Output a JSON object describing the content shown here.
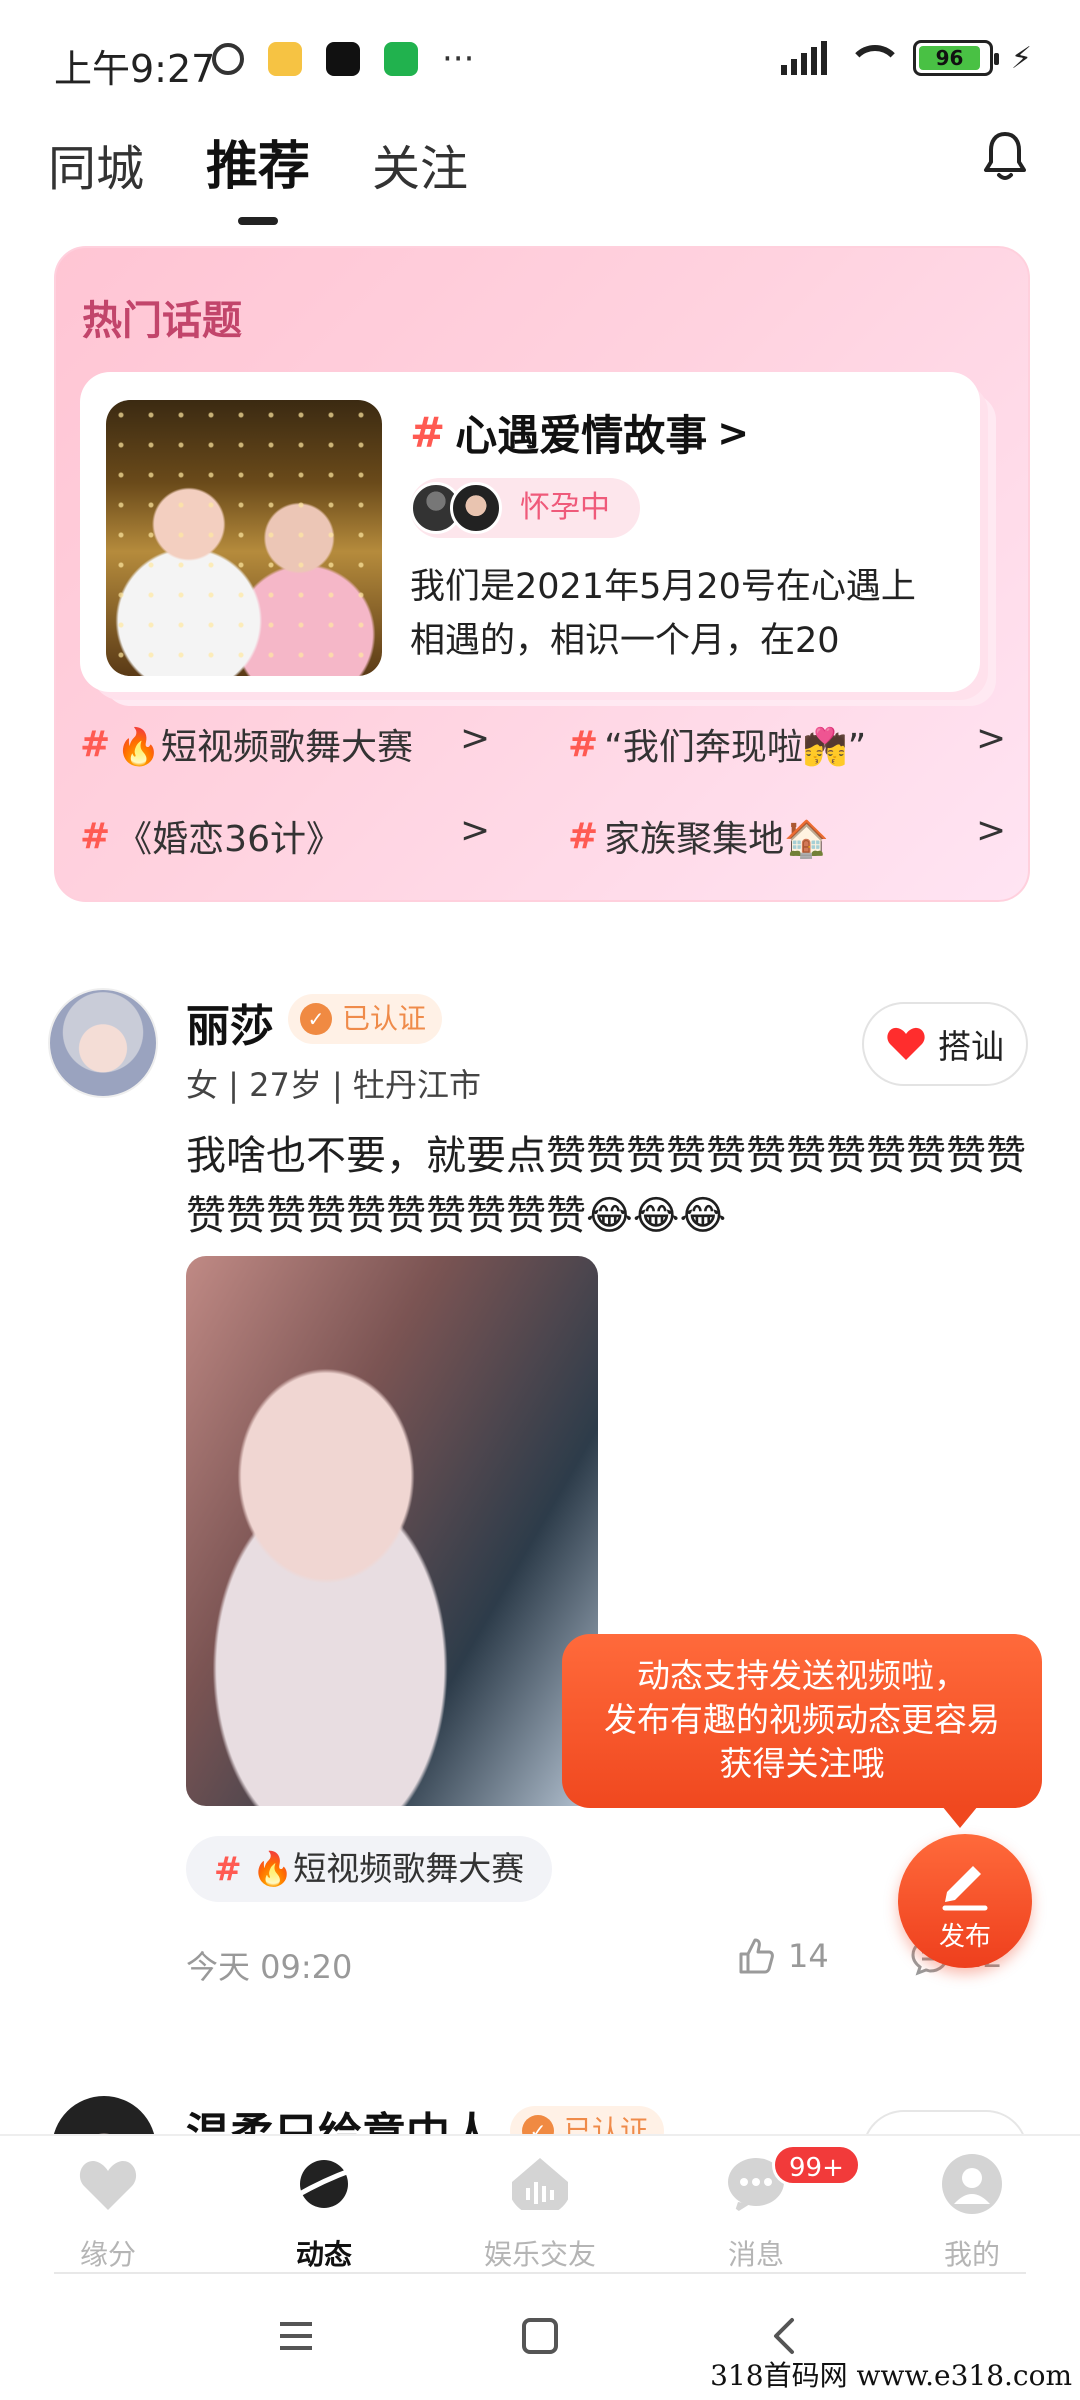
{
  "status_bar": {
    "time": "上午9:27",
    "more": "···",
    "battery": "96"
  },
  "tabs": {
    "nearby": "同城",
    "recommend": "推荐",
    "follow": "关注"
  },
  "hot_topics": {
    "title": "热门话题",
    "featured": {
      "hash": "#",
      "title": "心遇爱情故事",
      "arrow": ">",
      "tag": "怀孕中",
      "text": "我们是2021年5月20号在心遇上相遇的，相识一个月，在20"
    },
    "items": [
      {
        "hash": "#",
        "label": "🔥短视频歌舞大赛"
      },
      {
        "hash": "#",
        "label": "“我们奔现啦💏”"
      },
      {
        "hash": "#",
        "label": "《婚恋36计》"
      },
      {
        "hash": "#",
        "label": "家族聚集地🏠"
      }
    ],
    "chevron": ">"
  },
  "post": {
    "name": "丽莎",
    "verified": "已认证",
    "meta": "女 | 27岁 | 牡丹江市",
    "chat_button": "搭讪",
    "text": "我啥也不要，就要点赞赞赞赞赞赞赞赞赞赞赞赞赞赞赞赞赞赞赞赞赞赞😂😂😂",
    "topic_hash": "#",
    "topic": "🔥短视频歌舞大赛",
    "time": "今天 09:20",
    "likes": "14",
    "comments": "12"
  },
  "tooltip": {
    "line1": "动态支持发送视频啦，",
    "line2": "发布有趣的视频动态更容易",
    "line3": "获得关注哦"
  },
  "fab": {
    "label": "发布"
  },
  "next_post": {
    "name": "温柔只给意中人",
    "verified": "已认证"
  },
  "bottom_nav": {
    "items": [
      {
        "label": "缘分"
      },
      {
        "label": "动态"
      },
      {
        "label": "娱乐交友"
      },
      {
        "label": "消息"
      },
      {
        "label": "我的"
      }
    ],
    "badge": "99+"
  },
  "watermark": "318首码网  www.e318.com"
}
